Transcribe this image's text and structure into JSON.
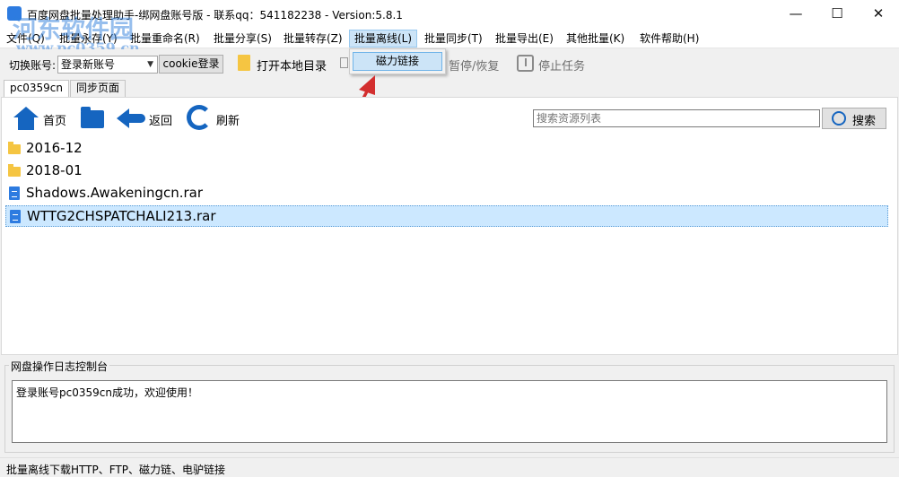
{
  "window": {
    "title": "百度网盘批量处理助手-绑网盘账号版 - 联系qq：541182238 - Version:5.8.1",
    "controls": {
      "minimize": "—",
      "maximize": "☐",
      "close": "✕"
    }
  },
  "menubar": {
    "items": [
      {
        "label": "文件(Q)"
      },
      {
        "label": "批量永存(Y)"
      },
      {
        "label": "批量重命名(R)"
      },
      {
        "label": "批量分享(S)"
      },
      {
        "label": "批量转存(Z)"
      },
      {
        "label": "批量离线(L)"
      },
      {
        "label": "批量同步(T)"
      },
      {
        "label": "批量导出(E)"
      },
      {
        "label": "其他批量(K)"
      },
      {
        "label": "软件帮助(H)"
      }
    ]
  },
  "dropdown": {
    "item": "磁力链接"
  },
  "toolbar": {
    "switch_label": "切换账号:",
    "account_value": "登录新账号",
    "cookie_btn": "cookie登录",
    "open_dir": "打开本地目录",
    "pause_resume": "暂停/恢复",
    "stop_task": "停止任务"
  },
  "tabs": [
    {
      "label": "pc0359cn",
      "selected": true
    },
    {
      "label": "同步页面",
      "selected": false
    }
  ],
  "nav": {
    "home": "首页",
    "back": "返回",
    "refresh": "刷新"
  },
  "search": {
    "placeholder": "搜索资源列表",
    "button": "搜索"
  },
  "files": [
    {
      "name": "2016-12",
      "type": "folder"
    },
    {
      "name": "2018-01",
      "type": "folder"
    },
    {
      "name": "Shadows.Awakeningcn.rar",
      "type": "file"
    },
    {
      "name": "WTTG2CHSPATCHALI213.rar",
      "type": "file",
      "selected": true
    }
  ],
  "log": {
    "title": "网盘操作日志控制台",
    "message": "登录账号pc0359cn成功，欢迎使用！"
  },
  "status": "批量离线下载HTTP、FTP、磁力链、电驴链接",
  "watermark": {
    "main": "河东软件园",
    "url": "www.pc0359.cn"
  },
  "colors": {
    "accent": "#1565c0",
    "selection": "#cce8ff",
    "folder": "#f5c542"
  }
}
